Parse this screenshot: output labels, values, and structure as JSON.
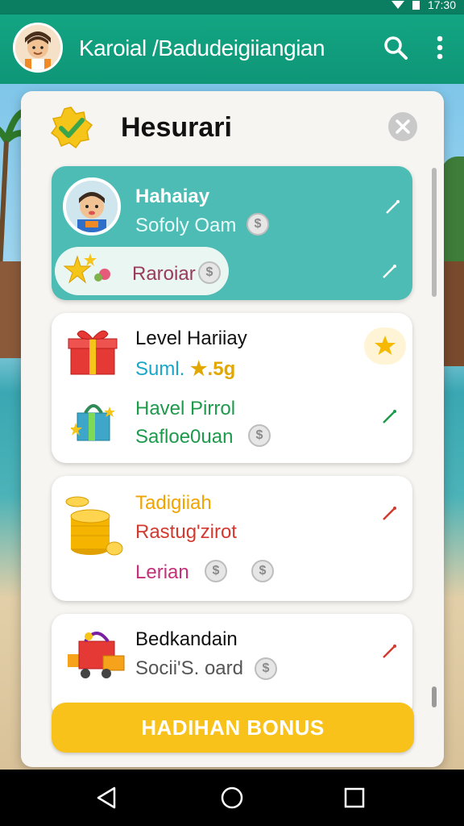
{
  "status_bar": {
    "time": "17:30"
  },
  "app_bar": {
    "title": "Karoial /Badudeigiiangian",
    "search_icon": "search-icon",
    "more_icon": "more-vert-icon"
  },
  "dialog": {
    "title": "Hesurari",
    "badge_icon": "check-badge-icon",
    "close_icon": "close-icon",
    "coin_symbol": "$",
    "cards": [
      {
        "name": "Hahaiay",
        "subtitle": "Sofoly Oam",
        "pill_label": "Raroiar"
      },
      {
        "name": "Level Hariiay",
        "stat_prefix": "Suml.",
        "stat_value": "★.5g",
        "name2": "Havel Pirrol",
        "subtitle2": "Safloe0uan"
      },
      {
        "name": "Tadigiiah",
        "subtitle": "Rastug'zirot",
        "subtitle2": "Lerian"
      },
      {
        "name": "Bedkandain",
        "subtitle": "Socii'S. oard"
      }
    ],
    "bonus_button": "HADIHAN BONUS"
  },
  "colors": {
    "app_bar": "#13a583",
    "card_highlight": "#4cbcb5",
    "bonus": "#f8c21b",
    "accent_green": "#1d9a4b",
    "accent_red": "#d23a30"
  }
}
